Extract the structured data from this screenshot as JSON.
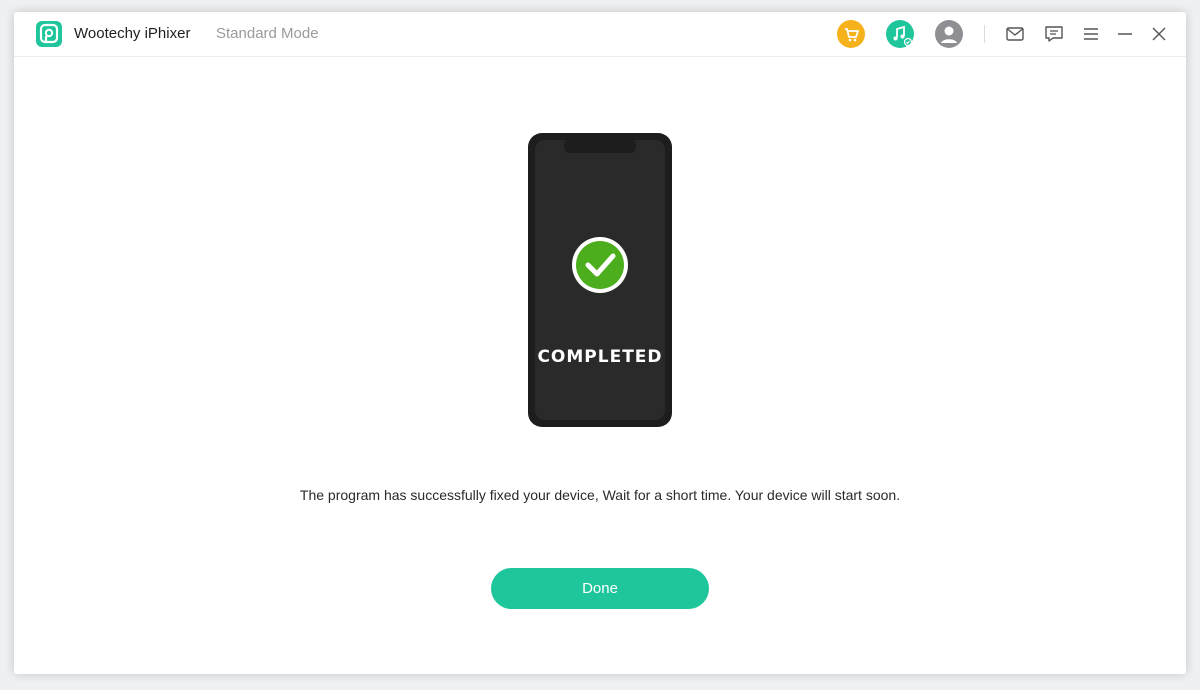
{
  "titlebar": {
    "app_title": "Wootechy iPhixer",
    "mode": "Standard Mode",
    "icons": [
      "cart-icon",
      "music-icon",
      "user-icon",
      "mail-icon",
      "feedback-icon",
      "menu-icon",
      "minimize-icon",
      "close-icon"
    ]
  },
  "main": {
    "status": "COMPLETED",
    "message": "The program has successfully fixed your device, Wait for a short time. Your device will start soon.",
    "done_label": "Done"
  },
  "colors": {
    "accent": "#1fc59b",
    "cart": "#f6b21b",
    "success": "#4cae1d",
    "phone": "#1d1d1d"
  }
}
